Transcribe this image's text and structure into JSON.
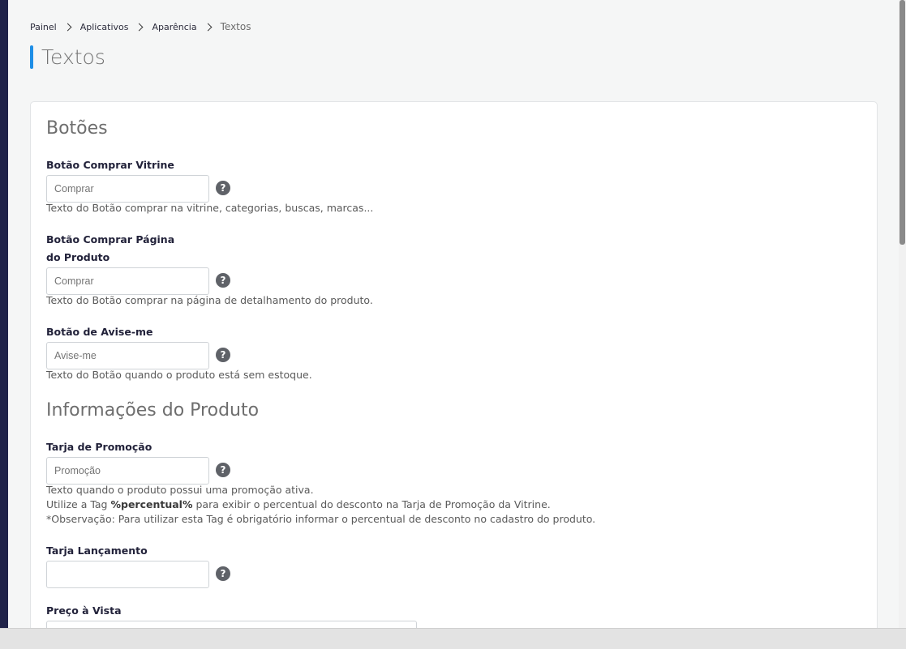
{
  "breadcrumb": {
    "items": [
      "Painel",
      "Aplicativos",
      "Aparência"
    ],
    "current": "Textos"
  },
  "page_title": "Textos",
  "sections": {
    "buttons": {
      "title": "Botões",
      "fields": [
        {
          "label": "Botão Comprar Vitrine",
          "placeholder": "Comprar",
          "help": "?",
          "hint": "Texto do Botão comprar na vitrine, categorias, buscas, marcas..."
        },
        {
          "label": "Botão Comprar Página do Produto",
          "placeholder": "Comprar",
          "help": "?",
          "hint": "Texto do Botão comprar na página de detalhamento do produto."
        },
        {
          "label": "Botão de Avise-me",
          "placeholder": "Avise-me",
          "help": "?",
          "hint": "Texto do Botão quando o produto está sem estoque."
        }
      ]
    },
    "product_info": {
      "title": "Informações do Produto",
      "fields": [
        {
          "label": "Tarja de Promoção",
          "placeholder": "Promoção",
          "help": "?",
          "hint_line1": "Texto quando o produto possui uma promoção ativa.",
          "hint_line2_pre": "Utilize a Tag ",
          "hint_line2_tag": "%percentual%",
          "hint_line2_post": " para exibir o percentual do desconto na Tarja de Promoção da Vitrine.",
          "hint_line3": "*Observação: Para utilizar esta Tag é obrigatório informar o percentual de desconto no cadastro do produto."
        },
        {
          "label": "Tarja Lançamento",
          "placeholder": "",
          "help": "?"
        },
        {
          "label": "Preço à Vista"
        }
      ]
    }
  },
  "colors": {
    "accent": "#1e8ee6",
    "sidebar": "#1f2248",
    "help_icon": "#5f6268"
  }
}
